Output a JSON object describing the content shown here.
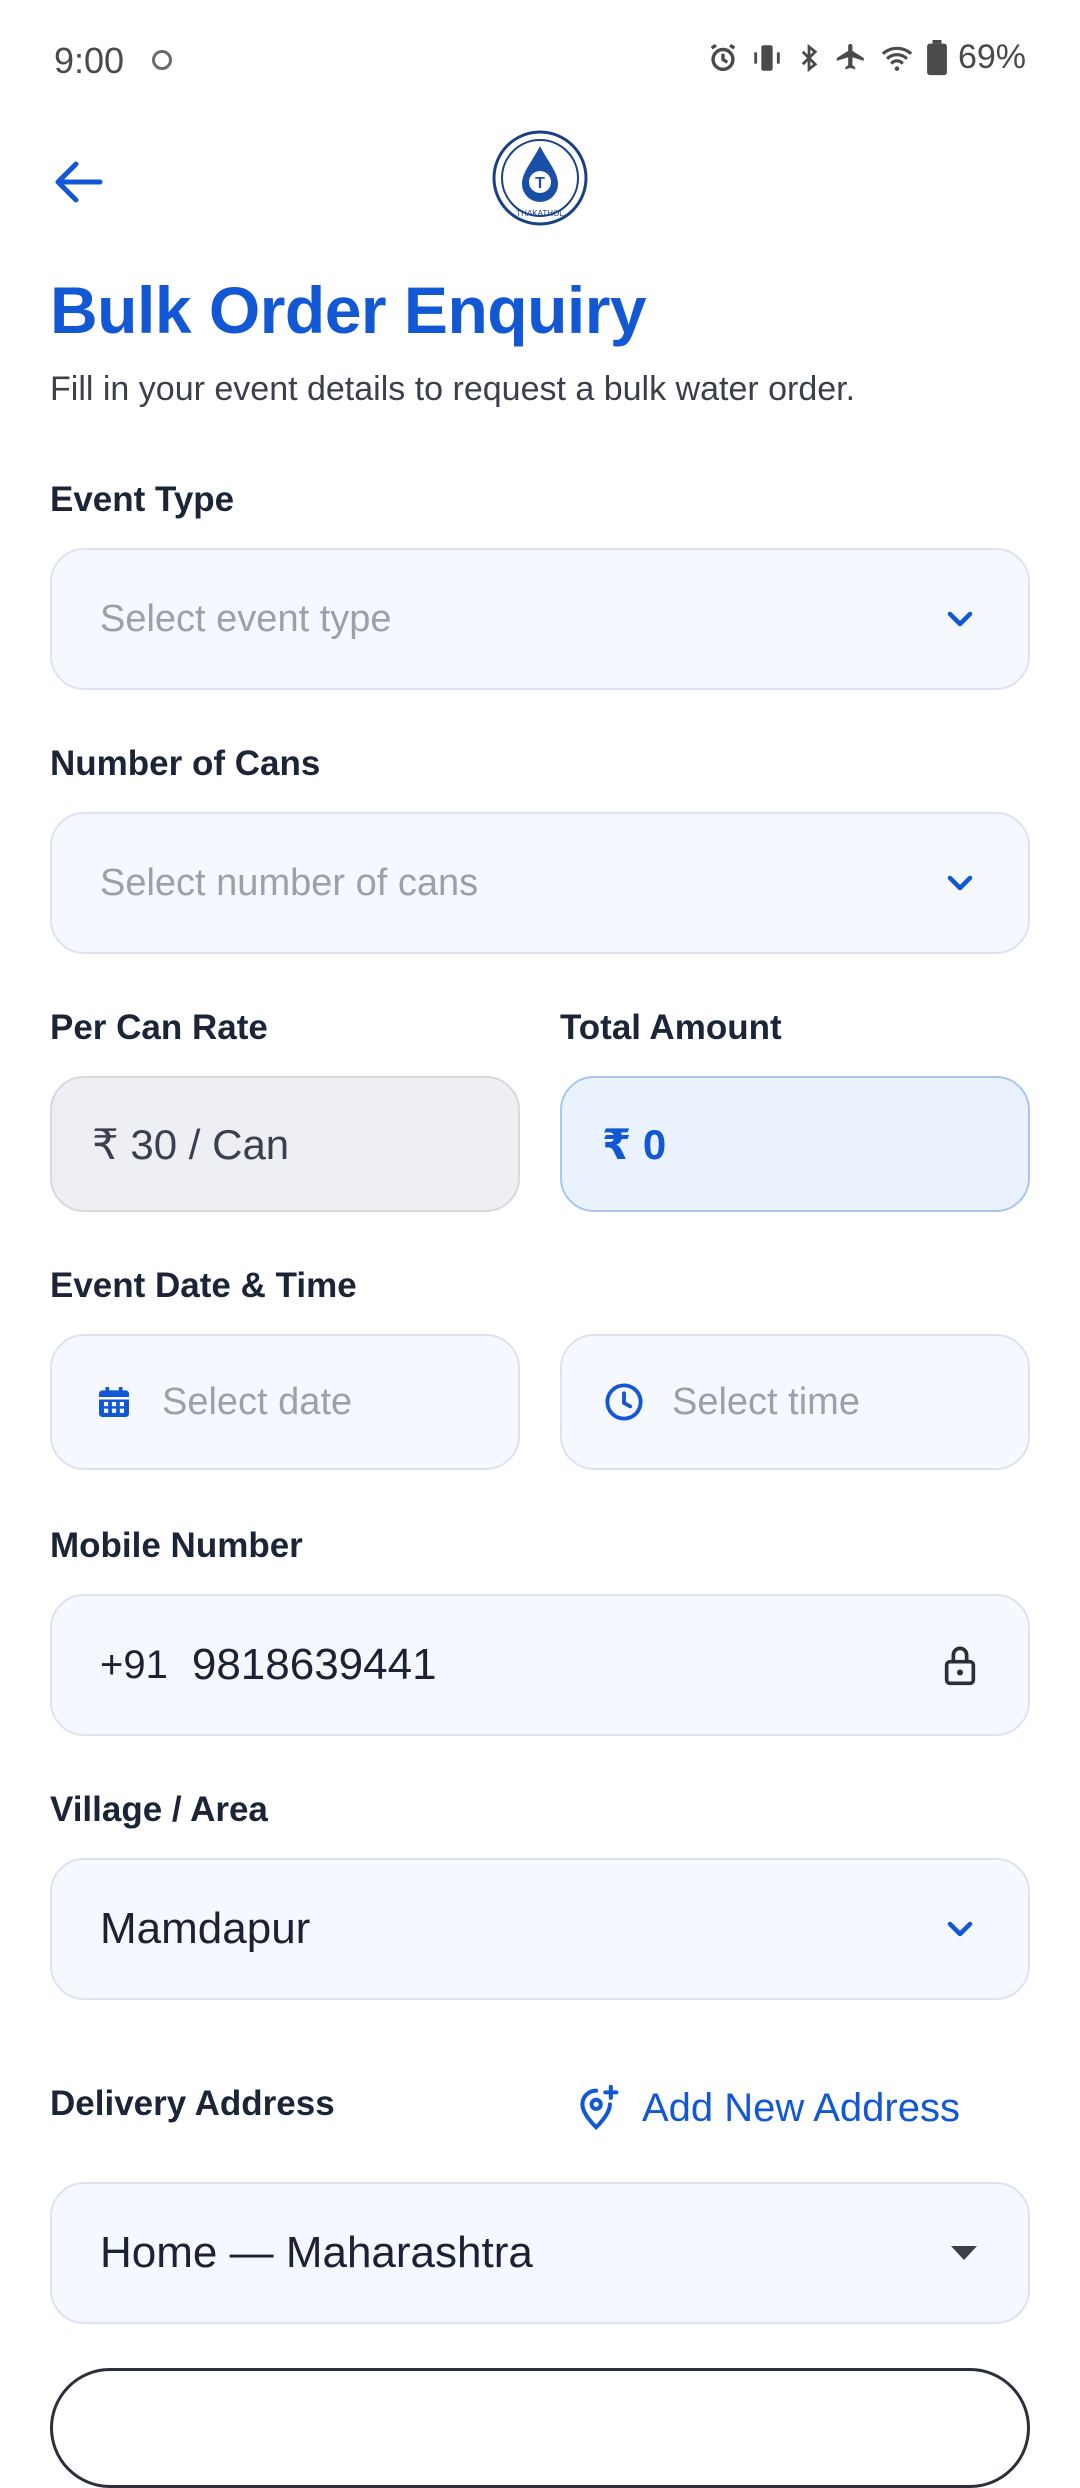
{
  "status": {
    "time": "9:00",
    "battery": "69%"
  },
  "header": {
    "back_icon": "arrow-left-icon",
    "logo_text": "THAKATHOL"
  },
  "page": {
    "title": "Bulk Order Enquiry",
    "subtitle": "Fill in your event details to request a bulk water order."
  },
  "form": {
    "event_type": {
      "label": "Event Type",
      "placeholder": "Select event type"
    },
    "cans": {
      "label": "Number of Cans",
      "placeholder": "Select number of cans"
    },
    "rate": {
      "label": "Per Can Rate",
      "value": "₹ 30 / Can"
    },
    "total": {
      "label": "Total Amount",
      "value": "₹ 0"
    },
    "datetime": {
      "label": "Event Date & Time",
      "date_placeholder": "Select date",
      "time_placeholder": "Select time"
    },
    "mobile": {
      "label": "Mobile Number",
      "code": "+91",
      "value": "9818639441"
    },
    "village": {
      "label": "Village / Area",
      "value": "Mamdapur"
    },
    "address": {
      "label": "Delivery Address",
      "add_label": "Add New Address",
      "value": "Home — Maharashtra"
    }
  },
  "colors": {
    "accent": "#1257d4",
    "field_bg": "#f5f8fe",
    "field_border": "#dde3ee"
  }
}
